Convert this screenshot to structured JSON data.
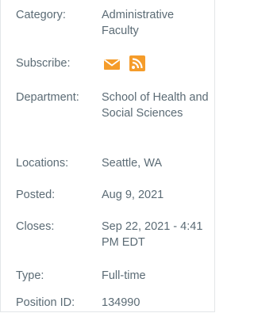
{
  "details": {
    "category_label": "Category:",
    "category_value": "Administrative Faculty",
    "subscribe_label": "Subscribe:",
    "subscribe_icons": [
      "email-icon",
      "rss-icon"
    ],
    "accent_color": "#f59c2a",
    "department_label": "Department:",
    "department_value": "School of Health and Social Sciences",
    "locations_label": "Locations:",
    "locations_value": "Seattle, WA",
    "posted_label": "Posted:",
    "posted_value": "Aug 9, 2021",
    "closes_label": "Closes:",
    "closes_value": "Sep 22, 2021 - 4:41 PM EDT",
    "type_label": "Type:",
    "type_value": "Full-time",
    "position_id_label": "Position ID:",
    "position_id_value": "134990"
  }
}
